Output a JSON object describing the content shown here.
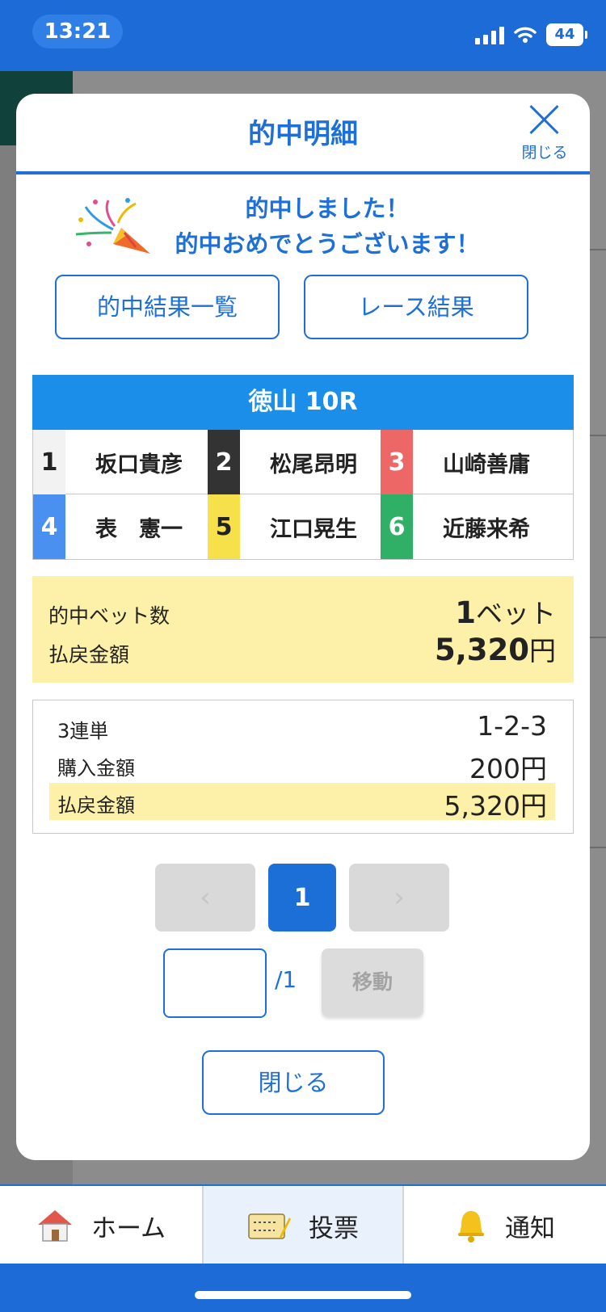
{
  "status_bar": {
    "time": "13:21",
    "battery": "44"
  },
  "modal": {
    "title": "的中明細",
    "close_label": "閉じる",
    "congrats_line1": "的中しました！",
    "congrats_line2": "的中おめでとうございます！",
    "buttons": {
      "hit_results_list": "的中結果一覧",
      "race_results": "レース結果"
    },
    "race": {
      "title": "徳山 10R",
      "racers": [
        {
          "lane": "1",
          "name": "坂口貴彦",
          "lane_bg": "#f2f2f2",
          "lane_fg": "#222222"
        },
        {
          "lane": "2",
          "name": "松尾昂明",
          "lane_bg": "#333333",
          "lane_fg": "#ffffff"
        },
        {
          "lane": "3",
          "name": "山崎善庸",
          "lane_bg": "#ee6767",
          "lane_fg": "#ffffff"
        },
        {
          "lane": "4",
          "name": "表　憲一",
          "lane_bg": "#4a90f0",
          "lane_fg": "#ffffff"
        },
        {
          "lane": "5",
          "name": "江口晃生",
          "lane_bg": "#f7e14a",
          "lane_fg": "#222222"
        },
        {
          "lane": "6",
          "name": "近藤来希",
          "lane_bg": "#2fb066",
          "lane_fg": "#ffffff"
        }
      ]
    },
    "summary": {
      "bets_label": "的中ベット数",
      "bets_value": "1",
      "bets_unit": "ベット",
      "payout_label": "払戻金額",
      "payout_value": "5,320",
      "payout_unit": "円"
    },
    "detail": {
      "bet_type_label": "3連単",
      "bet_combo": "1-2-3",
      "purchase_label": "購入金額",
      "purchase_value": "200円",
      "payout_label": "払戻金額",
      "payout_value": "5,320円"
    },
    "pagination": {
      "prev": "‹",
      "current": "1",
      "next": "›",
      "total": "/1",
      "move_button": "移動"
    },
    "close_button": "閉じる"
  },
  "tab_bar": {
    "home": "ホーム",
    "vote": "投票",
    "notify": "通知"
  },
  "colors": {
    "brand_blue": "#1f6fd8",
    "highlight_yellow": "#fdf0a8",
    "race_header_blue": "#1a8ee8"
  }
}
